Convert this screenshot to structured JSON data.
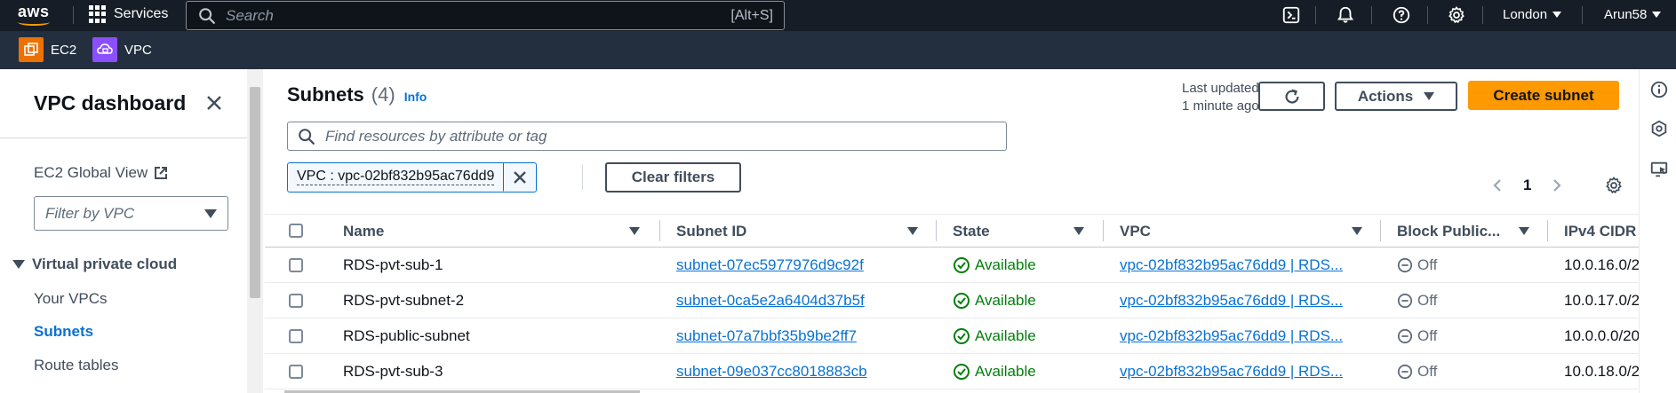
{
  "topnav": {
    "logo_text": "aws",
    "services_label": "Services",
    "search_placeholder": "Search",
    "search_shortcut": "[Alt+S]",
    "region_label": "London",
    "user_label": "Arun58"
  },
  "favorites": [
    {
      "label": "EC2",
      "color": "#ed7100"
    },
    {
      "label": "VPC",
      "color": "#8c4fff"
    }
  ],
  "sidebar": {
    "title": "VPC dashboard",
    "ec2_global_view": "EC2 Global View",
    "filter_placeholder": "Filter by VPC",
    "section_label": "Virtual private cloud",
    "items": [
      "Your VPCs",
      "Subnets",
      "Route tables"
    ],
    "active_item": "Subnets"
  },
  "main": {
    "title": "Subnets",
    "count": "(4)",
    "info_link": "Info",
    "last_updated_line1": "Last updated",
    "last_updated_line2": "1 minute ago",
    "actions_label": "Actions",
    "create_label": "Create subnet",
    "find_placeholder": "Find resources by attribute or tag",
    "filter_token": "VPC : vpc-02bf832b95ac76dd9",
    "clear_filters_label": "Clear filters",
    "current_page": "1"
  },
  "table": {
    "columns": [
      "Name",
      "Subnet ID",
      "State",
      "VPC",
      "Block Public...",
      "IPv4 CIDR"
    ],
    "rows": [
      {
        "name": "RDS-pvt-sub-1",
        "subnet_id": "subnet-07ec5977976d9c92f",
        "state": "Available",
        "vpc": "vpc-02bf832b95ac76dd9 | RDS...",
        "block": "Off",
        "cidr": "10.0.16.0/2"
      },
      {
        "name": "RDS-pvt-subnet-2",
        "subnet_id": "subnet-0ca5e2a6404d37b5f",
        "state": "Available",
        "vpc": "vpc-02bf832b95ac76dd9 | RDS...",
        "block": "Off",
        "cidr": "10.0.17.0/2"
      },
      {
        "name": "RDS-public-subnet",
        "subnet_id": "subnet-07a7bbf35b9be2ff7",
        "state": "Available",
        "vpc": "vpc-02bf832b95ac76dd9 | RDS...",
        "block": "Off",
        "cidr": "10.0.0.0/20"
      },
      {
        "name": "RDS-pvt-sub-3",
        "subnet_id": "subnet-09e037cc8018883cb",
        "state": "Available",
        "vpc": "vpc-02bf832b95ac76dd9 | RDS...",
        "block": "Off",
        "cidr": "10.0.18.0/2"
      }
    ]
  },
  "colors": {
    "nav_bg": "#161d26",
    "subnav_bg": "#232f3e",
    "primary": "#ff9900",
    "link": "#0972d3",
    "success": "#037f0c"
  }
}
